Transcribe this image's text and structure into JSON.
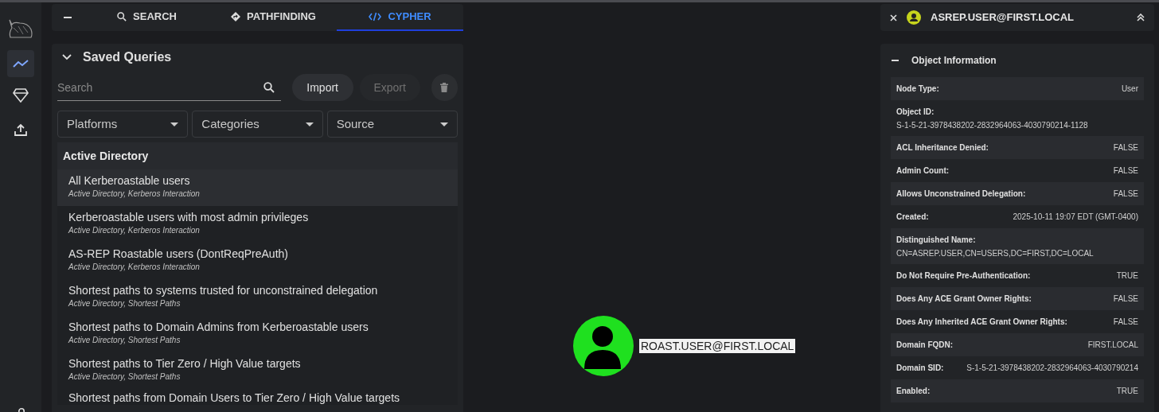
{
  "tabs": [
    {
      "label": "SEARCH",
      "selected": false
    },
    {
      "label": "PATHFINDING",
      "selected": false
    },
    {
      "label": "CYPHER",
      "selected": true
    }
  ],
  "saved_queries": {
    "title": "Saved Queries",
    "search": {
      "placeholder": "Search"
    },
    "buttons": [
      {
        "label": "Import",
        "disabled": false
      },
      {
        "label": "Export",
        "disabled": true
      }
    ],
    "filters": [
      "Platforms",
      "Categories",
      "Source"
    ],
    "group": "Active Directory",
    "queries": [
      {
        "title": "All Kerberoastable users",
        "tags": "Active Directory, Kerberos Interaction",
        "selected": true
      },
      {
        "title": "Kerberoastable users with most admin privileges",
        "tags": "Active Directory, Kerberos Interaction",
        "selected": false
      },
      {
        "title": "AS-REP Roastable users (DontReqPreAuth)",
        "tags": "Active Directory, Kerberos Interaction",
        "selected": false
      },
      {
        "title": "Shortest paths to systems trusted for unconstrained delegation",
        "tags": "Active Directory, Shortest Paths",
        "selected": false
      },
      {
        "title": "Shortest paths to Domain Admins from Kerberoastable users",
        "tags": "Active Directory, Shortest Paths",
        "selected": false
      },
      {
        "title": "Shortest paths to Tier Zero / High Value targets",
        "tags": "Active Directory, Shortest Paths",
        "selected": false
      },
      {
        "title": "Shortest paths from Domain Users to Tier Zero / High Value targets",
        "selected": false
      }
    ]
  },
  "graph": {
    "node": {
      "label": "ROAST.USER@FIRST.LOCAL",
      "color": "#1fe01f"
    }
  },
  "entity_panel": {
    "title": "ASREP.USER@FIRST.LOCAL",
    "color": "#c6d41c",
    "section": "Object Information",
    "properties": [
      {
        "kind": "inline",
        "label": "Node Type:",
        "value": "User"
      },
      {
        "kind": "stacked",
        "label": "Object ID:",
        "value": "S-1-5-21-3978438202-2832964063-4030790214-1128"
      },
      {
        "kind": "inline",
        "label": "ACL Inheritance Denied:",
        "value": "FALSE"
      },
      {
        "kind": "inline",
        "label": "Admin Count:",
        "value": "FALSE"
      },
      {
        "kind": "inline",
        "label": "Allows Unconstrained Delegation:",
        "value": "FALSE"
      },
      {
        "kind": "inline",
        "label": "Created:",
        "value": "2025-10-11 19:07 EDT (GMT-0400)"
      },
      {
        "kind": "stacked",
        "label": "Distinguished Name:",
        "value": "CN=ASREP.USER,CN=USERS,DC=FIRST,DC=LOCAL"
      },
      {
        "kind": "inline",
        "label": "Do Not Require Pre-Authentication:",
        "value": "TRUE"
      },
      {
        "kind": "inline",
        "label": "Does Any ACE Grant Owner Rights:",
        "value": "FALSE"
      },
      {
        "kind": "inline",
        "label": "Does Any Inherited ACE Grant Owner Rights:",
        "value": "FALSE"
      },
      {
        "kind": "inline",
        "label": "Domain FQDN:",
        "value": "FIRST.LOCAL"
      },
      {
        "kind": "inline",
        "label": "Domain SID:",
        "value": "S-1-5-21-3978438202-2832964063-4030790214"
      },
      {
        "kind": "inline",
        "label": "Enabled:",
        "value": "TRUE"
      }
    ]
  }
}
